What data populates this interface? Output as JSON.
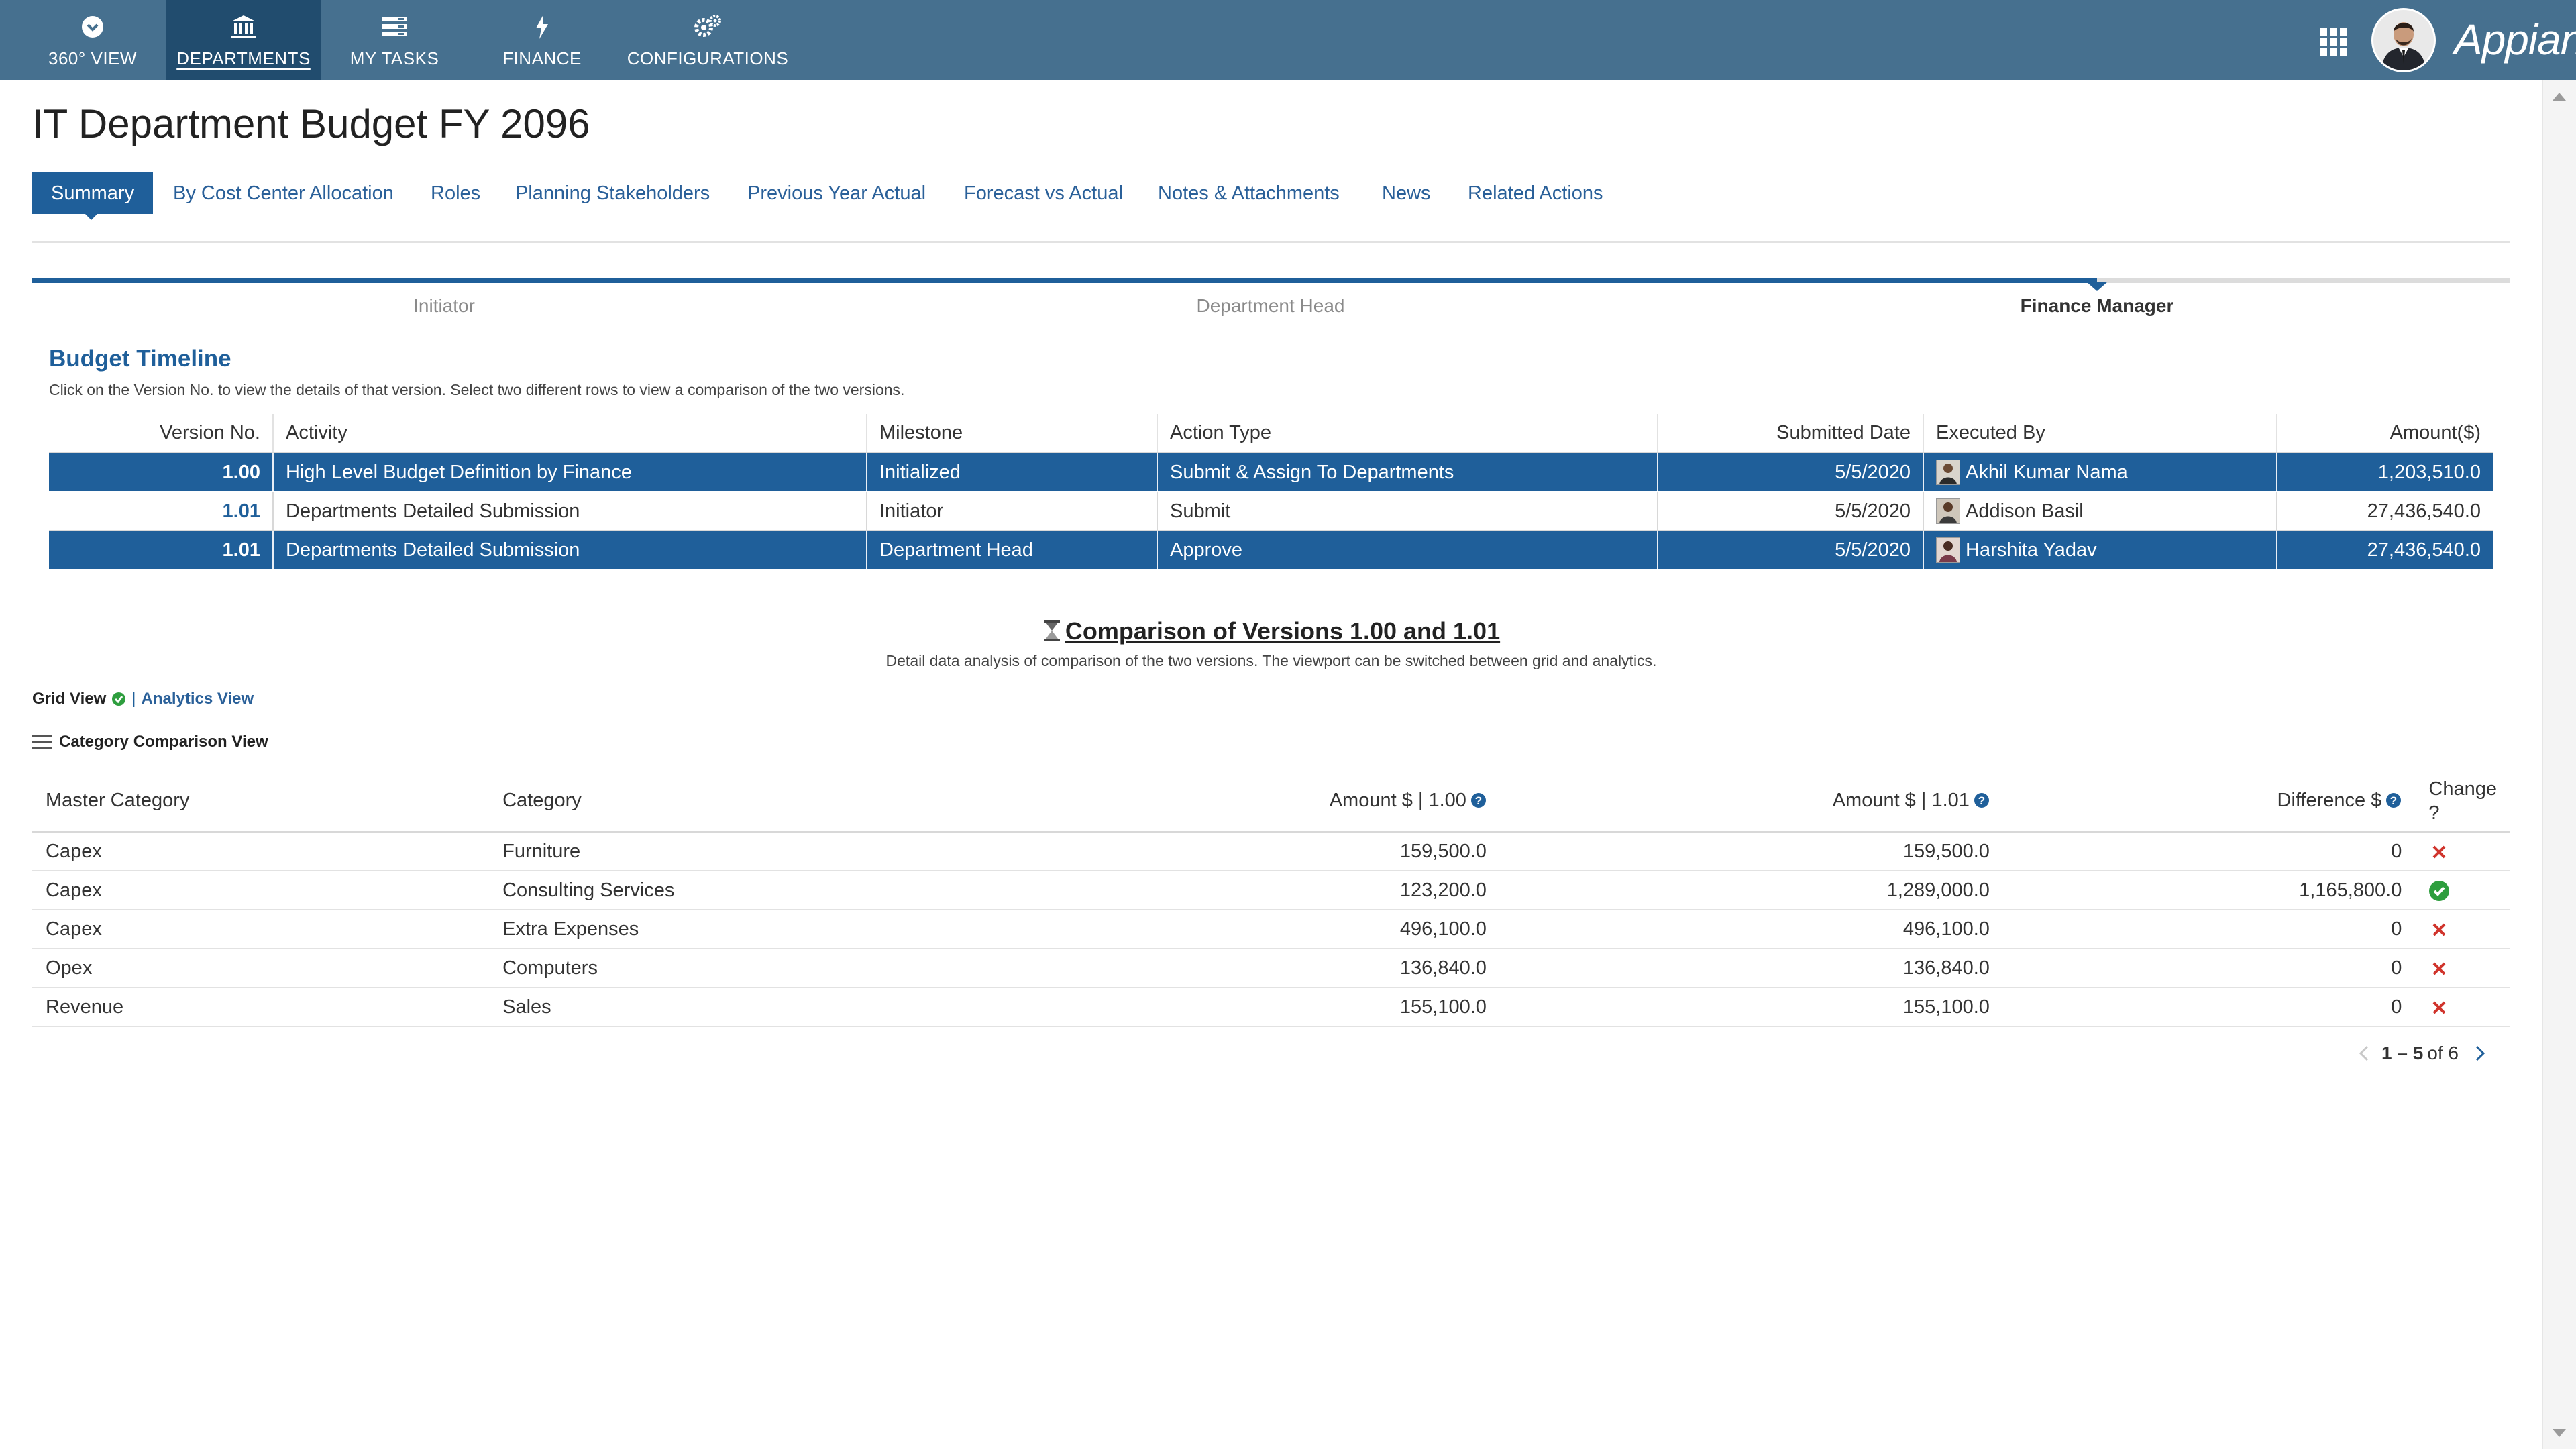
{
  "nav": {
    "items": [
      {
        "label": "360° VIEW",
        "icon": "chevron-down-circle-icon"
      },
      {
        "label": "DEPARTMENTS",
        "icon": "bank-icon",
        "active": true
      },
      {
        "label": "MY TASKS",
        "icon": "tasks-list-icon"
      },
      {
        "label": "FINANCE",
        "icon": "lightning-icon"
      },
      {
        "label": "CONFIGURATIONS",
        "icon": "gears-icon"
      }
    ],
    "brand": "Appian"
  },
  "page": {
    "title": "IT Department Budget FY 2096"
  },
  "tabs": [
    {
      "label": "Summary",
      "active": true
    },
    {
      "label": "By Cost Center Allocation"
    },
    {
      "label": "Roles"
    },
    {
      "label": "Planning Stakeholders"
    },
    {
      "label": "Previous Year Actual"
    },
    {
      "label": "Forecast vs Actual"
    },
    {
      "label": "Notes & Attachments"
    },
    {
      "label": "News"
    },
    {
      "label": "Related Actions"
    }
  ],
  "stepper": {
    "steps": [
      {
        "label": "Initiator"
      },
      {
        "label": "Department Head"
      },
      {
        "label": "Finance Manager",
        "current": true
      }
    ]
  },
  "timeline": {
    "title": "Budget Timeline",
    "subtitle": "Click on the Version No. to view the details of that version. Select two different rows to view a comparison of the two versions.",
    "columns": {
      "version": "Version No.",
      "activity": "Activity",
      "milestone": "Milestone",
      "action_type": "Action Type",
      "submitted_date": "Submitted Date",
      "executed_by": "Executed By",
      "amount": "Amount($)"
    },
    "rows": [
      {
        "version": "1.00",
        "activity": "High Level Budget Definition by Finance",
        "milestone": "Initialized",
        "action_type": "Submit & Assign To Departments",
        "submitted_date": "5/5/2020",
        "executed_by": "Akhil Kumar Nama",
        "amount": "1,203,510.0",
        "selected": true
      },
      {
        "version": "1.01",
        "activity": "Departments Detailed Submission",
        "milestone": "Initiator",
        "action_type": "Submit",
        "submitted_date": "5/5/2020",
        "executed_by": "Addison Basil",
        "amount": "27,436,540.0",
        "selected": false
      },
      {
        "version": "1.01",
        "activity": "Departments Detailed Submission",
        "milestone": "Department Head",
        "action_type": "Approve",
        "submitted_date": "5/5/2020",
        "executed_by": "Harshita Yadav",
        "amount": "27,436,540.0",
        "selected": true
      }
    ]
  },
  "comparison": {
    "title": "Comparison of Versions 1.00 and 1.01",
    "subtitle": "Detail data analysis of comparison of the two versions. The viewport can be switched between grid and analytics.",
    "grid_view_label": "Grid View",
    "separator": "|",
    "analytics_view_label": "Analytics View",
    "category_view_label": "Category Comparison View",
    "columns": {
      "master_category": "Master Category",
      "category": "Category",
      "amount_v1": "Amount $ | 1.00",
      "amount_v2": "Amount $ | 1.01",
      "difference": "Difference $",
      "change": "Change ?"
    },
    "rows": [
      {
        "master_category": "Capex",
        "category": "Furniture",
        "amount_v1": "159,500.0",
        "amount_v2": "159,500.0",
        "difference": "0",
        "changed": false
      },
      {
        "master_category": "Capex",
        "category": "Consulting Services",
        "amount_v1": "123,200.0",
        "amount_v2": "1,289,000.0",
        "difference": "1,165,800.0",
        "changed": true
      },
      {
        "master_category": "Capex",
        "category": "Extra Expenses",
        "amount_v1": "496,100.0",
        "amount_v2": "496,100.0",
        "difference": "0",
        "changed": false
      },
      {
        "master_category": "Opex",
        "category": "Computers",
        "amount_v1": "136,840.0",
        "amount_v2": "136,840.0",
        "difference": "0",
        "changed": false
      },
      {
        "master_category": "Revenue",
        "category": "Sales",
        "amount_v1": "155,100.0",
        "amount_v2": "155,100.0",
        "difference": "0",
        "changed": false
      }
    ],
    "pager": {
      "range": "1 – 5",
      "of_text": "of 6"
    }
  },
  "colors": {
    "nav_bg": "#46708f",
    "nav_active": "#214c6e",
    "accent": "#1f5f9a",
    "changed_green": "#2e9e3e",
    "unchanged_red": "#d0342c"
  }
}
